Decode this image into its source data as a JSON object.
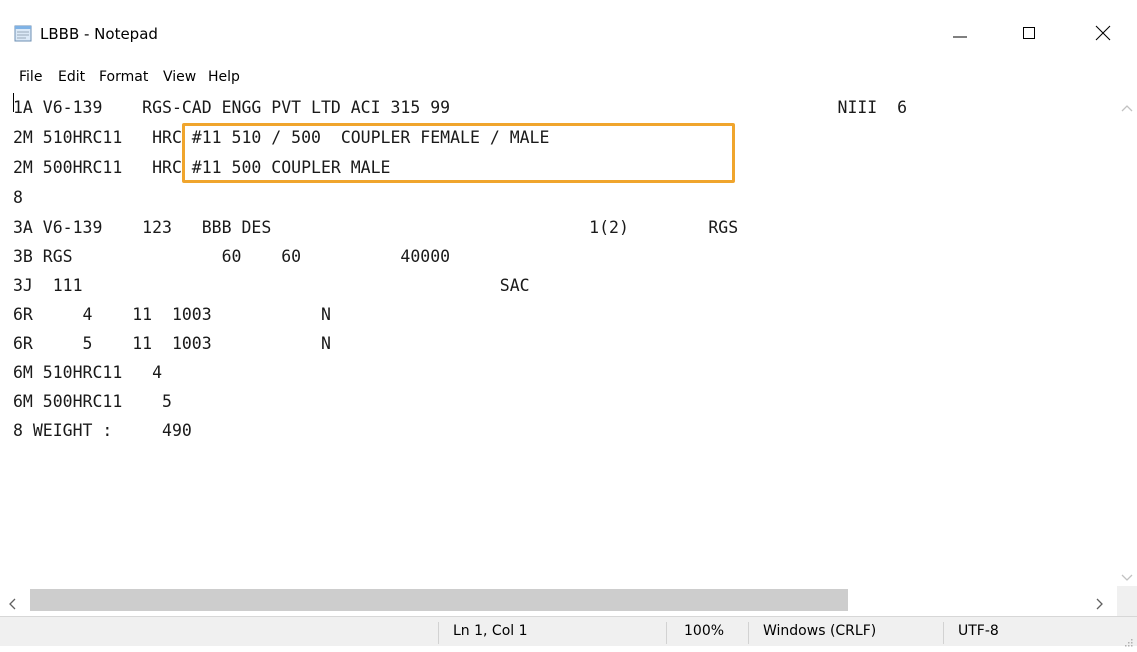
{
  "window": {
    "title": "LBBB - Notepad",
    "icon": "notepad-icon",
    "controls": [
      "minimize-icon",
      "maximize-icon",
      "close-icon"
    ]
  },
  "menu": [
    "File",
    "Edit",
    "Format",
    "View",
    "Help"
  ],
  "editor": {
    "lines": [
      "1A V6-139    RGS-CAD ENGG PVT LTD ACI 315 99                                       NIII  6",
      "2M 510HRC11   HRC #11 510 / 500  COUPLER FEMALE / MALE",
      "2M 500HRC11   HRC #11 500 COUPLER MALE",
      "8",
      "3A V6-139    123   BBB DES                                1(2)        RGS",
      "3B RGS               60    60          40000",
      "3J  111                                          SAC",
      "6R     4    11  1003           N",
      "6R     5    11  1003           N",
      "6M 510HRC11   4",
      "6M 500HRC11    5",
      "8 WEIGHT :     490"
    ],
    "highlight_color": "#f0a52d"
  },
  "status": {
    "position": "Ln 1, Col 1",
    "zoom": "100%",
    "line_ending": "Windows (CRLF)",
    "encoding": "UTF-8"
  }
}
